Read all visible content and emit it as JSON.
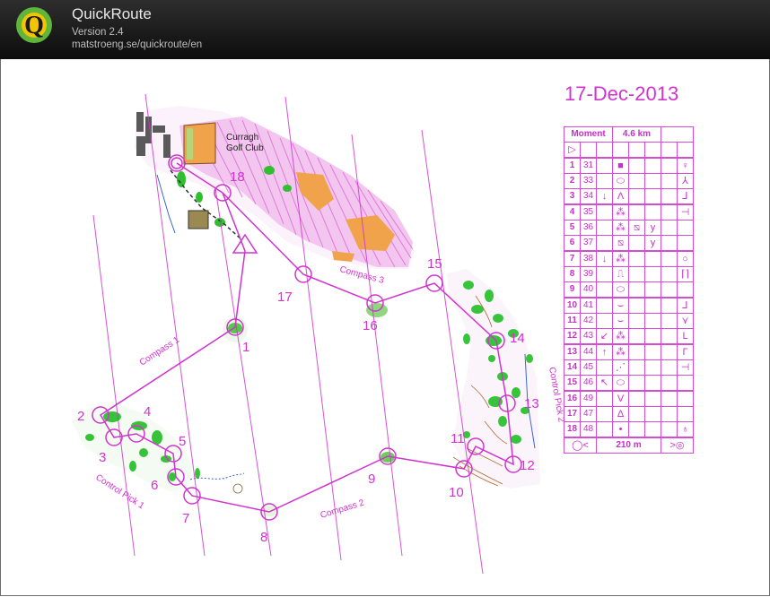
{
  "app": {
    "title": "QuickRoute",
    "version": "Version 2.4",
    "url": "matstroeng.se/quickroute/en",
    "logo_letter": "Q",
    "logo_icon": "quickroute-q-logo"
  },
  "map": {
    "date": "17-Dec-2013",
    "club_label_line1": "Curragh",
    "club_label_line2": "Golf Club",
    "course_color": "#d133cf",
    "controls": [
      "1",
      "2",
      "3",
      "4",
      "5",
      "6",
      "7",
      "8",
      "9",
      "10",
      "11",
      "12",
      "13",
      "14",
      "15",
      "16",
      "17",
      "18"
    ],
    "leg_labels": {
      "compass_1": "Compass 1",
      "compass_2": "Compass 2",
      "compass_3": "Compass 3",
      "control_pick_1": "Control Pick 1",
      "control_pick_2": "Control Pick 2"
    }
  },
  "description": {
    "event": "Moment",
    "length": "4.6 km",
    "finish_distance": "210 m",
    "rows": [
      {
        "num": "1",
        "code": "31",
        "c": "",
        "d": "■",
        "e": "",
        "f": "",
        "g": "♀"
      },
      {
        "num": "2",
        "code": "33",
        "c": "",
        "d": "⬭",
        "e": "",
        "f": "",
        "g": "⅄"
      },
      {
        "num": "3",
        "code": "34",
        "c": "↓",
        "d": "Λ",
        "e": "",
        "f": "",
        "g": "⅃"
      },
      {
        "num": "4",
        "code": "35",
        "c": "",
        "d": "⁂",
        "e": "",
        "f": "",
        "g": "⊣"
      },
      {
        "num": "5",
        "code": "36",
        "c": "",
        "d": "⁂",
        "e": "⧅",
        "f": "y",
        "g": ""
      },
      {
        "num": "6",
        "code": "37",
        "c": "",
        "d": "⧅",
        "e": "",
        "f": "y",
        "g": ""
      },
      {
        "num": "7",
        "code": "38",
        "c": "↓",
        "d": "⁂",
        "e": "",
        "f": "",
        "g": "○"
      },
      {
        "num": "8",
        "code": "39",
        "c": "",
        "d": "⎍",
        "e": "",
        "f": "",
        "g": "⌈⌉"
      },
      {
        "num": "9",
        "code": "40",
        "c": "",
        "d": "⬭",
        "e": "",
        "f": "",
        "g": ""
      },
      {
        "num": "10",
        "code": "41",
        "c": "",
        "d": "⌣",
        "e": "",
        "f": "",
        "g": "⅃"
      },
      {
        "num": "11",
        "code": "42",
        "c": "",
        "d": "⌣",
        "e": "",
        "f": "",
        "g": "⋎"
      },
      {
        "num": "12",
        "code": "43",
        "c": "↙",
        "d": "⁂",
        "e": "",
        "f": "",
        "g": "L"
      },
      {
        "num": "13",
        "code": "44",
        "c": "↑",
        "d": "⁂",
        "e": "",
        "f": "",
        "g": "Γ"
      },
      {
        "num": "14",
        "code": "45",
        "c": "",
        "d": "⋰",
        "e": "",
        "f": "",
        "g": "⊣"
      },
      {
        "num": "15",
        "code": "46",
        "c": "↖",
        "d": "⬭",
        "e": "",
        "f": "",
        "g": ""
      },
      {
        "num": "16",
        "code": "49",
        "c": "",
        "d": "V",
        "e": "",
        "f": "",
        "g": ""
      },
      {
        "num": "17",
        "code": "47",
        "c": "",
        "d": "Δ",
        "e": "",
        "f": "",
        "g": ""
      },
      {
        "num": "18",
        "code": "48",
        "c": "",
        "d": "•",
        "e": "",
        "f": "",
        "g": "♁"
      }
    ]
  }
}
